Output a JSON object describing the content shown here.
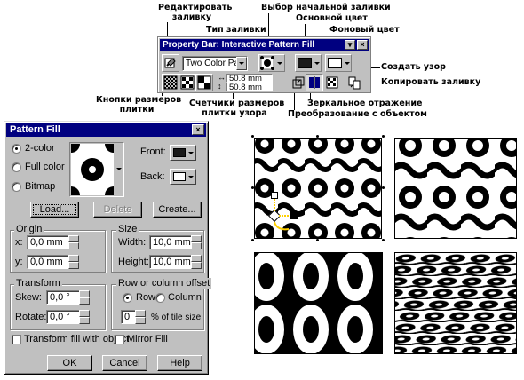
{
  "annotations": {
    "edit_fill": [
      "Редактировать",
      "заливку"
    ],
    "fill_type": "Тип заливки",
    "start_fill": "Выбор начальной заливки",
    "main_color": "Основной цвет",
    "bg_color": "Фоновый цвет",
    "create_pattern": "Создать узор",
    "copy_fill": "Копировать заливку",
    "size_buttons": [
      "Кнопки размеров",
      "плитки"
    ],
    "size_counters": [
      "Счетчики размеров",
      "плитки узора"
    ],
    "mirror": "Зеркальное отражение",
    "transform_with_object": "Преобразование с объектом"
  },
  "property_bar": {
    "title": "Property Bar: Interactive Pattern Fill",
    "fill_type_value": "Two Color Patt...",
    "width_value": "50.8 mm",
    "height_value": "50.8 mm",
    "colors": {
      "front": "#1a1a1a",
      "back": "#ffffff"
    }
  },
  "dialog": {
    "title": "Pattern Fill",
    "radios": {
      "two_color": "2-color",
      "full_color": "Full color",
      "bitmap": "Bitmap"
    },
    "front_label": "Front:",
    "back_label": "Back:",
    "buttons": {
      "load": "Load...",
      "delete": "Delete",
      "create": "Create...",
      "ok": "OK",
      "cancel": "Cancel",
      "help": "Help"
    },
    "origin": {
      "label": "Origin",
      "x_label": "x:",
      "x_value": "0,0 mm",
      "y_label": "y:",
      "y_value": "0,0 mm"
    },
    "size": {
      "label": "Size",
      "width_label": "Width:",
      "width_value": "10,0 mm",
      "height_label": "Height:",
      "height_value": "10,0 mm"
    },
    "transform": {
      "label": "Transform",
      "skew_label": "Skew:",
      "skew_value": "0,0 °",
      "rotate_label": "Rotate:",
      "rotate_value": "0,0 °"
    },
    "offset": {
      "label": "Row or column offset",
      "row": "Row",
      "column": "Column",
      "value": "0",
      "unit_label": "% of tile size"
    },
    "transform_fill_label": "Transform fill with object",
    "mirror_fill_label": "Mirror Fill"
  }
}
